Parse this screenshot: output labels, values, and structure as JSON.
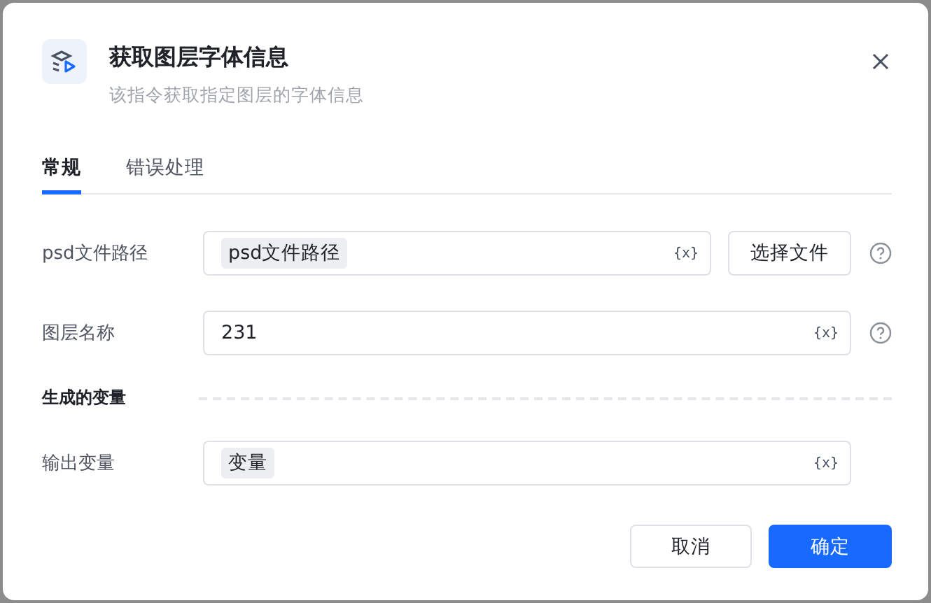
{
  "dialog": {
    "title": "获取图层字体信息",
    "subtitle": "该指令获取指定图层的字体信息"
  },
  "tabs": [
    {
      "label": "常规",
      "selected": true
    },
    {
      "label": "错误处理",
      "selected": false
    }
  ],
  "rows": [
    {
      "label": "psd文件路径",
      "field": {
        "kind": "token",
        "value": "psd文件路径",
        "var_marker": "{x}"
      },
      "button": "选择文件",
      "help": true
    },
    {
      "label": "图层名称",
      "field": {
        "kind": "text",
        "value": "231",
        "var_marker": "{x}"
      },
      "help": true
    }
  ],
  "section": {
    "title": "生成的变量"
  },
  "outputs": [
    {
      "label": "输出变量",
      "field": {
        "kind": "token",
        "value": "变量",
        "var_marker": "{x}"
      },
      "help": false
    }
  ],
  "footer": {
    "cancel": "取消",
    "ok": "确定"
  }
}
